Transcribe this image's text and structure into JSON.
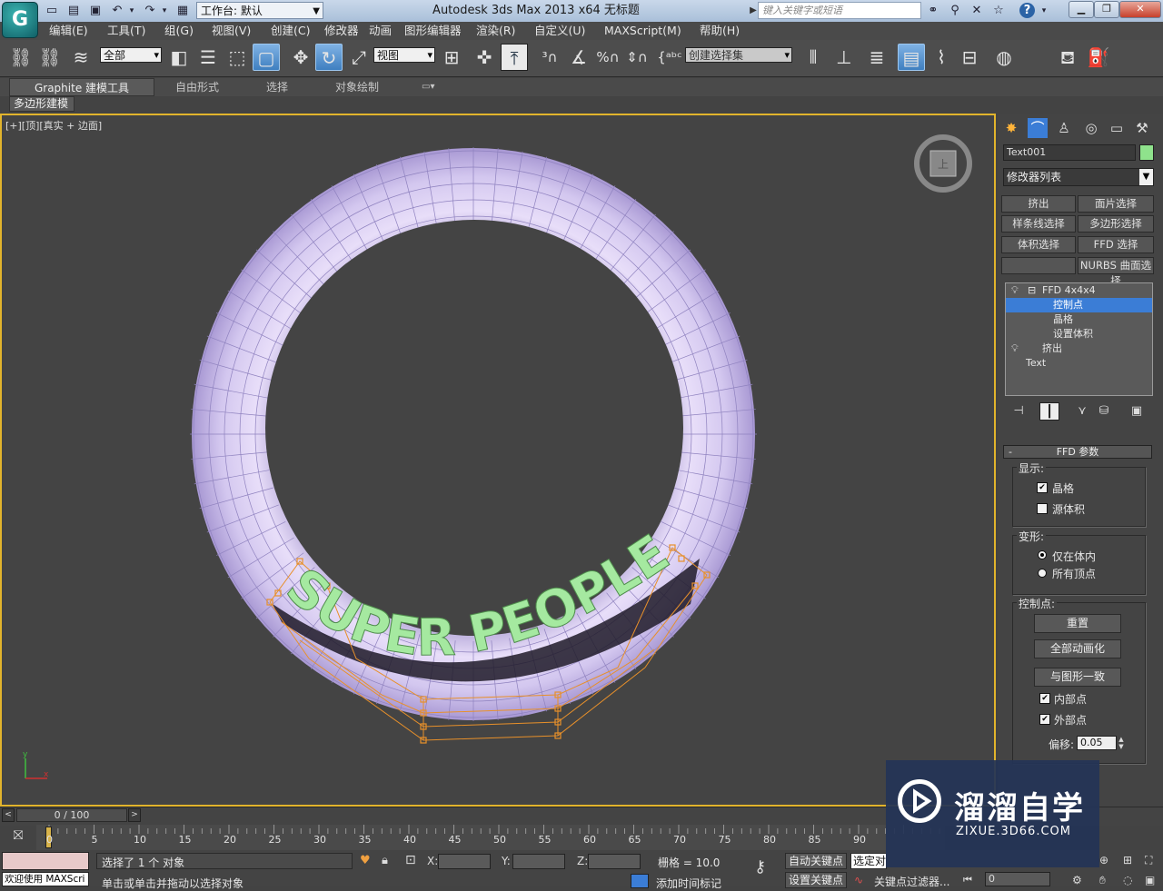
{
  "titlebar": {
    "workspace_label": "工作台: 默认",
    "window_title": "Autodesk 3ds Max  2013 x64      无标题",
    "search_placeholder": "键入关键字或短语"
  },
  "menu": [
    "编辑(E)",
    "工具(T)",
    "组(G)",
    "视图(V)",
    "创建(C)",
    "修改器",
    "动画",
    "图形编辑器",
    "渲染(R)",
    "自定义(U)",
    "MAXScript(M)",
    "帮助(H)"
  ],
  "toolbar": {
    "selection_filter": "全部",
    "ref_coord": "视图",
    "named_selection": "创建选择集"
  },
  "ribbon": {
    "tabs": [
      "Graphite 建模工具",
      "自由形式",
      "选择",
      "对象绘制"
    ],
    "sub_tab": "多边形建模"
  },
  "viewport": {
    "label": "[+][顶][真实 + 边面]",
    "viewcube_face": "上",
    "text_object": "SUPER PEOPLE",
    "mesh_color": "#d3c7ef",
    "text_color": "#a5e9a0",
    "active_border": "#e2b42c"
  },
  "command_panel": {
    "object_name": "Text001",
    "object_color": "#8fe28c",
    "modifier_list": "修改器列表",
    "modifier_buttons": [
      "挤出",
      "面片选择",
      "样条线选择",
      "多边形选择",
      "体积选择",
      "FFD 选择",
      "",
      "NURBS 曲面选择"
    ],
    "stack": [
      {
        "label": "FFD 4x4x4",
        "level": 0,
        "bulb": true,
        "expand": "⊟"
      },
      {
        "label": "控制点",
        "level": 1,
        "selected": true
      },
      {
        "label": "晶格",
        "level": 1
      },
      {
        "label": "设置体积",
        "level": 1
      },
      {
        "label": "挤出",
        "level": 0,
        "bulb": true
      },
      {
        "label": "Text",
        "level": 0
      }
    ],
    "rollout_title": "FFD 参数",
    "display_group": "显示:",
    "lattice_label": "晶格",
    "lattice_checked": true,
    "source_volume_label": "源体积",
    "source_volume_checked": false,
    "deform_group": "变形:",
    "only_in_volume_label": "仅在体内",
    "all_vertices_label": "所有顶点",
    "deform_mode": "only_in_volume",
    "control_points_group": "控制点:",
    "reset_button": "重置",
    "animate_all_button": "全部动画化",
    "conform_button": "与图形一致",
    "inside_points_label": "内部点",
    "inside_points_checked": true,
    "outside_points_label": "外部点",
    "outside_points_checked": true,
    "offset_label": "偏移:",
    "offset_value": "0.05"
  },
  "timeline": {
    "frame_display": "0 / 100",
    "ticks": [
      0,
      5,
      10,
      15,
      20,
      25,
      30,
      35,
      40,
      45,
      50,
      55,
      60,
      65,
      70,
      75,
      80,
      85,
      90
    ],
    "frame_count": 100
  },
  "status": {
    "maxscript_text": "欢迎使用 MAXScri",
    "selection_info": "选择了 1 个 对象",
    "prompt": "单击或单击并拖动以选择对象",
    "x_label": "X:",
    "y_label": "Y:",
    "z_label": "Z:",
    "grid": "栅格 = 10.0",
    "auto_key": "自动关键点",
    "selected_dd": "选定对象",
    "set_key": "设置关键点",
    "key_filters": "关键点过滤器...",
    "add_time_tag": "添加时间标记",
    "current_frame": "0"
  },
  "watermark": {
    "title": "溜溜自学",
    "url": "ZIXUE.3D66.COM"
  }
}
